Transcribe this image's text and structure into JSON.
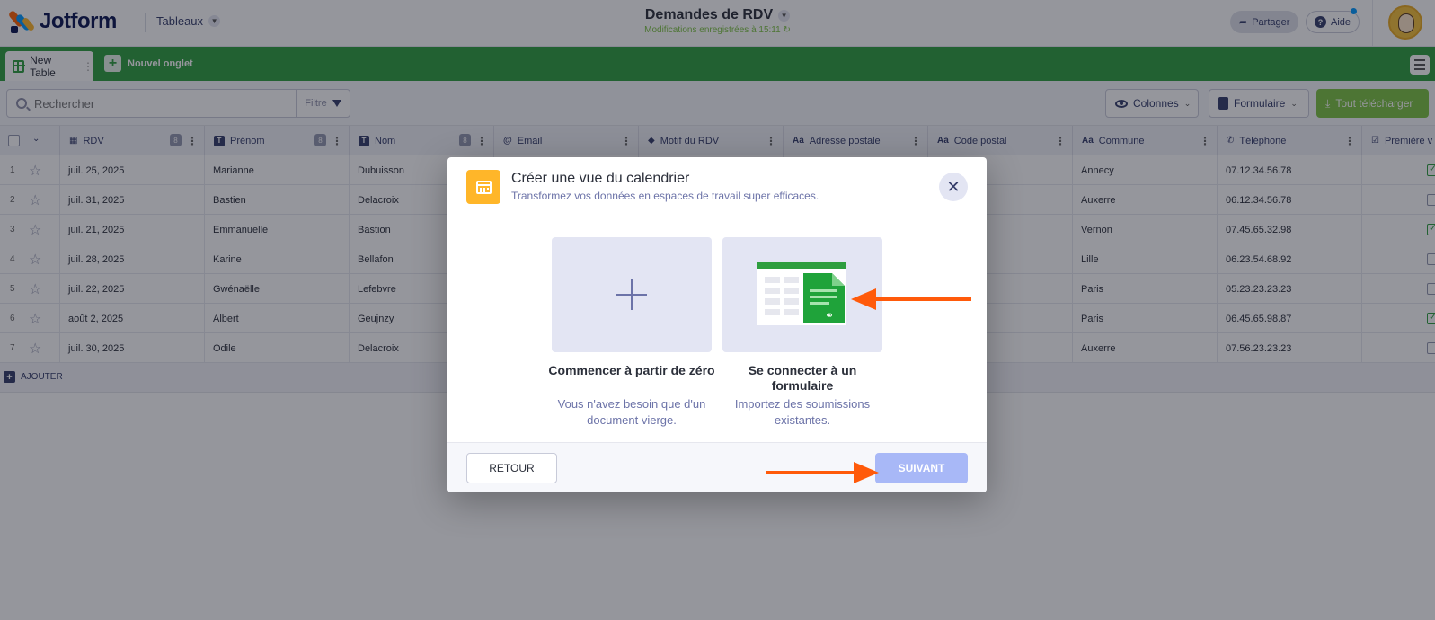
{
  "header": {
    "brand": "Jotform",
    "workspace": "Tableaux",
    "doc_title": "Demandes de RDV",
    "saved_status": "Modifications enregistrées à 15:11",
    "share_label": "Partager",
    "help_label": "Aide"
  },
  "tabs": {
    "active_label": "New Table",
    "new_tab_label": "Nouvel onglet"
  },
  "toolbar": {
    "search_placeholder": "Rechercher",
    "filter_label": "Filtre",
    "columns_label": "Colonnes",
    "form_label": "Formulaire",
    "download_label": "Tout télécharger"
  },
  "table": {
    "columns": [
      {
        "label": "RDV",
        "type_icon": "calendar-icon"
      },
      {
        "label": "Prénom",
        "type_icon": "text-type-icon"
      },
      {
        "label": "Nom",
        "type_icon": "text-type-icon"
      },
      {
        "label": "Email",
        "type_icon": "at-icon"
      },
      {
        "label": "Motif du RDV",
        "type_icon": "tag-icon"
      },
      {
        "label": "Adresse postale",
        "type_icon": "aa-type-icon"
      },
      {
        "label": "Code postal",
        "type_icon": "aa-type-icon"
      },
      {
        "label": "Commune",
        "type_icon": "aa-type-icon"
      },
      {
        "label": "Téléphone",
        "type_icon": "phone-icon"
      },
      {
        "label": "Première v",
        "type_icon": "checkbox-icon"
      }
    ],
    "rows": [
      {
        "num": "1",
        "rdv": "juil. 25, 2025",
        "prenom": "Marianne",
        "nom": "Dubuisson",
        "commune": "Annecy",
        "tel": "07.12.34.56.78",
        "premiere": true
      },
      {
        "num": "2",
        "rdv": "juil. 31, 2025",
        "prenom": "Bastien",
        "nom": "Delacroix",
        "commune": "Auxerre",
        "tel": "06.12.34.56.78",
        "premiere": false
      },
      {
        "num": "3",
        "rdv": "juil. 21, 2025",
        "prenom": "Emmanuelle",
        "nom": "Bastion",
        "commune": "Vernon",
        "tel": "07.45.65.32.98",
        "premiere": true
      },
      {
        "num": "4",
        "rdv": "juil. 28, 2025",
        "prenom": "Karine",
        "nom": "Bellafon",
        "commune": "Lille",
        "tel": "06.23.54.68.92",
        "premiere": false
      },
      {
        "num": "5",
        "rdv": "juil. 22, 2025",
        "prenom": "Gwénaëlle",
        "nom": "Lefebvre",
        "commune": "Paris",
        "tel": "05.23.23.23.23",
        "premiere": false
      },
      {
        "num": "6",
        "rdv": "août 2, 2025",
        "prenom": "Albert",
        "nom": "Geujnzy",
        "commune": "Paris",
        "tel": "06.45.65.98.87",
        "premiere": true
      },
      {
        "num": "7",
        "rdv": "juil. 30, 2025",
        "prenom": "Odile",
        "nom": "Delacroix",
        "commune": "Auxerre",
        "tel": "07.56.23.23.23",
        "premiere": false
      }
    ],
    "add_label": "AJOUTER"
  },
  "modal": {
    "title": "Créer une vue du calendrier",
    "subtitle": "Transformez vos données en espaces de travail super efficaces.",
    "option1_title": "Commencer à partir de zéro",
    "option1_desc": "Vous n'avez besoin que d'un document vierge.",
    "option2_title": "Se connecter à un formulaire",
    "option2_desc": "Importez des soumissions existantes.",
    "back_label": "RETOUR",
    "next_label": "SUIVANT"
  },
  "colors": {
    "brand_green": "#2e9e3e",
    "download_green": "#7dc342",
    "modal_icon": "#ffb629",
    "next_button": "#a8b8f7",
    "annotation_arrow": "#ff5a0a"
  }
}
